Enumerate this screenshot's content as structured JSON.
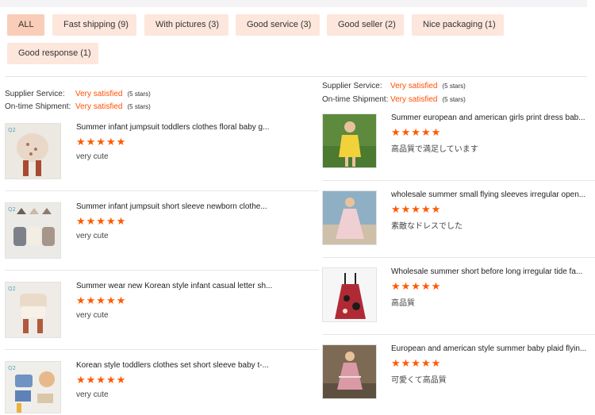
{
  "filters": [
    {
      "label": "ALL",
      "active": true
    },
    {
      "label": "Fast shipping (9)",
      "active": false
    },
    {
      "label": "With pictures (3)",
      "active": false
    },
    {
      "label": "Good service (3)",
      "active": false
    },
    {
      "label": "Good seller (2)",
      "active": false
    },
    {
      "label": "Nice packaging (1)",
      "active": false
    },
    {
      "label": "Good response (1)",
      "active": false
    }
  ],
  "left": {
    "supplier_service_label": "Supplier Service:",
    "supplier_service_value": "Very satisfied",
    "supplier_service_note": "(5 stars)",
    "shipment_label": "On-time Shipment:",
    "shipment_value": "Very satisfied",
    "shipment_note": "(5 stars)",
    "items": [
      {
        "title": "Summer infant jumpsuit toddlers clothes floral baby g...",
        "stars": "★★★★★",
        "comment": "very cute"
      },
      {
        "title": "Summer infant jumpsuit short sleeve newborn clothe...",
        "stars": "★★★★★",
        "comment": "very cute"
      },
      {
        "title": "Summer wear new Korean style infant casual letter sh...",
        "stars": "★★★★★",
        "comment": "very cute"
      },
      {
        "title": "Korean style toddlers clothes set short sleeve baby t-...",
        "stars": "★★★★★",
        "comment": "very cute"
      }
    ]
  },
  "right": {
    "supplier_service_label": "Supplier Service:",
    "supplier_service_value": "Very satisfied",
    "supplier_service_note": "(5 stars)",
    "shipment_label": "On-time Shipment:",
    "shipment_value": "Very satisfied",
    "shipment_note": "(5 stars)",
    "items": [
      {
        "title": "Summer european and american girls print dress bab...",
        "stars": "★★★★★",
        "comment": "高品質で満足しています"
      },
      {
        "title": "wholesale summer small flying sleeves irregular open...",
        "stars": "★★★★★",
        "comment": "素敵なドレスでした"
      },
      {
        "title": "Wholesale summer short before long irregular tide fa...",
        "stars": "★★★★★",
        "comment": "高品質"
      },
      {
        "title": "European and american style summer baby plaid flyin...",
        "stars": "★★★★★",
        "comment": "可愛くて高品質"
      }
    ]
  },
  "colors": {
    "accent": "#ff5a00",
    "tag_bg": "#fde6dc",
    "tag_active_bg": "#f9cdb8",
    "satisfied": "#ff4f00"
  }
}
